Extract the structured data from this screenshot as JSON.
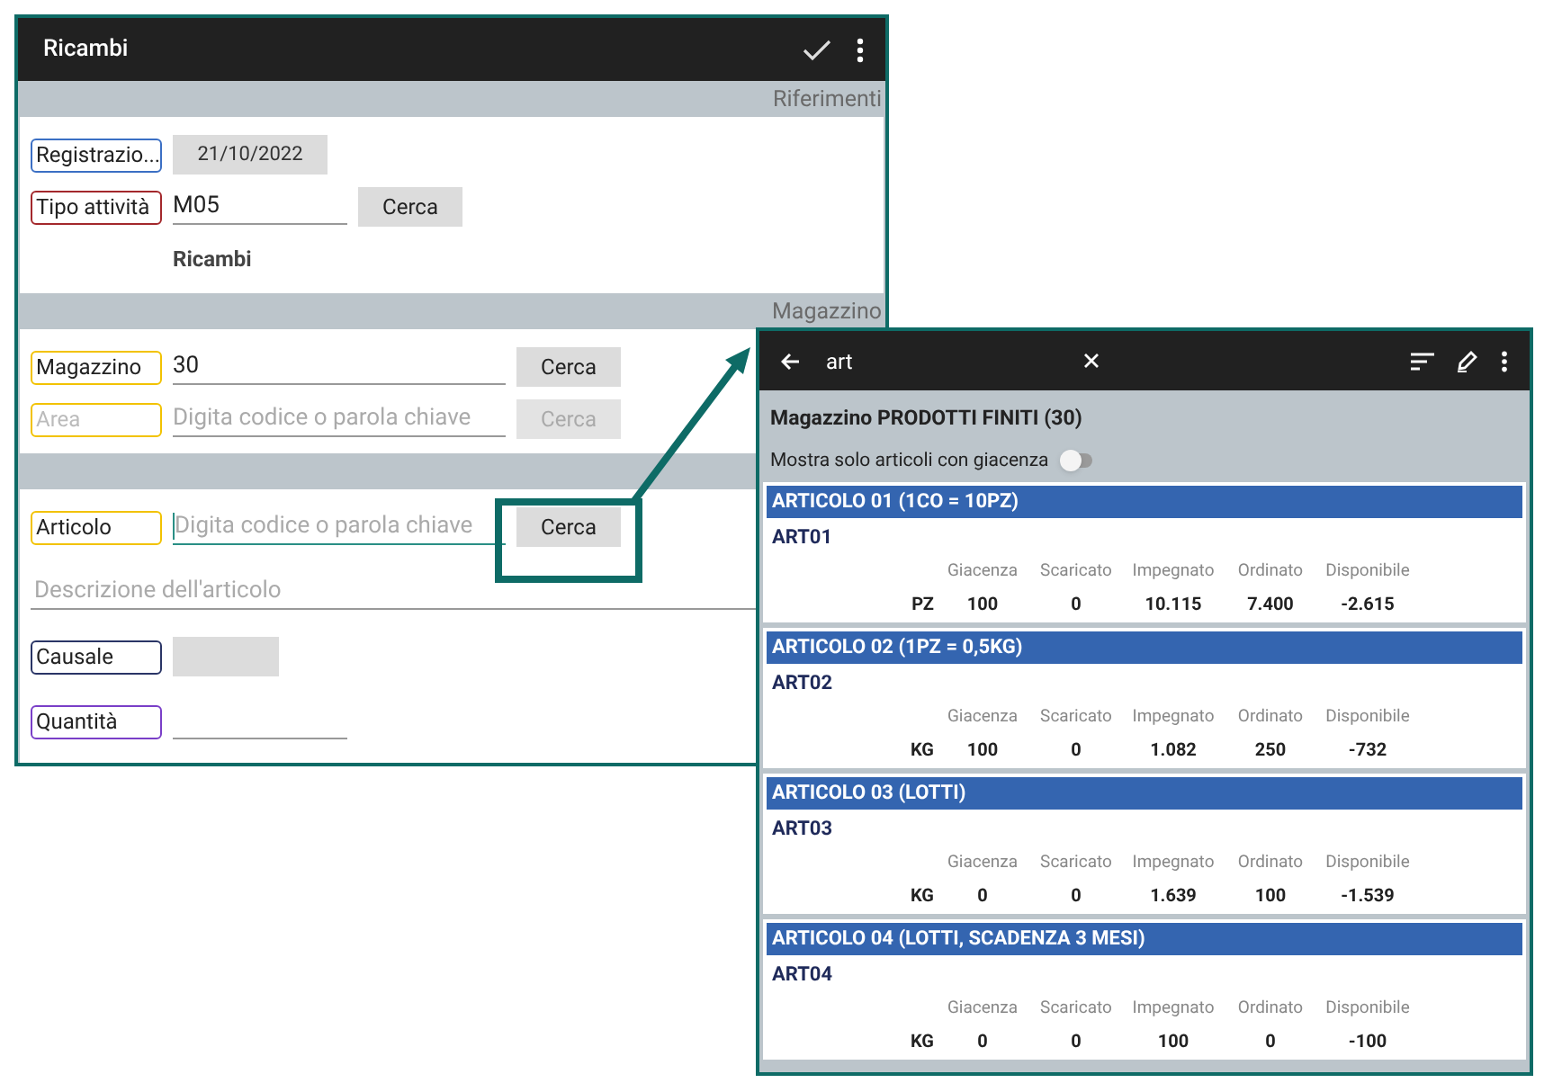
{
  "main_screen": {
    "title": "Ricambi",
    "sections": [
      {
        "header": "Riferimenti",
        "rows": [
          {
            "kind": "date",
            "label": "Registrazio...",
            "color": "#3b6fc4",
            "value": "21/10/2022"
          },
          {
            "kind": "lookup",
            "label": "Tipo attività",
            "color": "#a3282c",
            "value": "M05",
            "button": "Cerca",
            "disabled": false,
            "focused": false
          },
          {
            "kind": "caption",
            "text": "Ricambi"
          }
        ]
      },
      {
        "header": "Magazzino",
        "rows": [
          {
            "kind": "lookup",
            "label": "Magazzino",
            "color": "#f2c200",
            "value": "30",
            "button": "Cerca",
            "disabled": false,
            "focused": false
          },
          {
            "kind": "lookup",
            "label": "Area",
            "color": "#f2c200",
            "placeholder": "Digita codice o parola chiave",
            "button": "Cerca",
            "disabled": true,
            "focused": false
          }
        ]
      },
      {
        "rows": [
          {
            "kind": "lookup",
            "label": "Articolo",
            "color": "#f2c200",
            "placeholder": "Digita codice o parola chiave",
            "button": "Cerca",
            "disabled": false,
            "focused": true
          },
          {
            "kind": "text",
            "placeholder": "Descrizione dell'articolo"
          },
          {
            "kind": "choice",
            "label": "Causale",
            "color": "#2a3566"
          },
          {
            "kind": "number",
            "label": "Quantità",
            "color": "#7a3fc8"
          }
        ]
      }
    ]
  },
  "search_dialog": {
    "query": "art",
    "title": "Magazzino PRODOTTI FINITI (30)",
    "filter": {
      "label": "Mostra solo articoli con giacenza",
      "on": false
    },
    "articles": [
      {
        "name": "ARTICOLO 01 (1CO = 10PZ)",
        "code": "ART01",
        "columns": [
          "Giacenza",
          "Scaricato",
          "Impegnato",
          "Ordinato",
          "Disponibile"
        ],
        "unit": "PZ",
        "values": [
          "100",
          "0",
          "10.115",
          "7.400",
          "-2.615"
        ]
      },
      {
        "name": "ARTICOLO 02 (1PZ = 0,5KG)",
        "code": "ART02",
        "columns": [
          "Giacenza",
          "Scaricato",
          "Impegnato",
          "Ordinato",
          "Disponibile"
        ],
        "unit": "KG",
        "values": [
          "100",
          "0",
          "1.082",
          "250",
          "-732"
        ]
      },
      {
        "name": "ARTICOLO 03 (LOTTI)",
        "code": "ART03",
        "columns": [
          "Giacenza",
          "Scaricato",
          "Impegnato",
          "Ordinato",
          "Disponibile"
        ],
        "unit": "KG",
        "values": [
          "0",
          "0",
          "1.639",
          "100",
          "-1.539"
        ]
      },
      {
        "name": "ARTICOLO 04 (LOTTI, SCADENZA 3 MESI)",
        "code": "ART04",
        "columns": [
          "Giacenza",
          "Scaricato",
          "Impegnato",
          "Ordinato",
          "Disponibile"
        ],
        "unit": "KG",
        "values": [
          "0",
          "0",
          "100",
          "0",
          "-100"
        ]
      }
    ]
  }
}
